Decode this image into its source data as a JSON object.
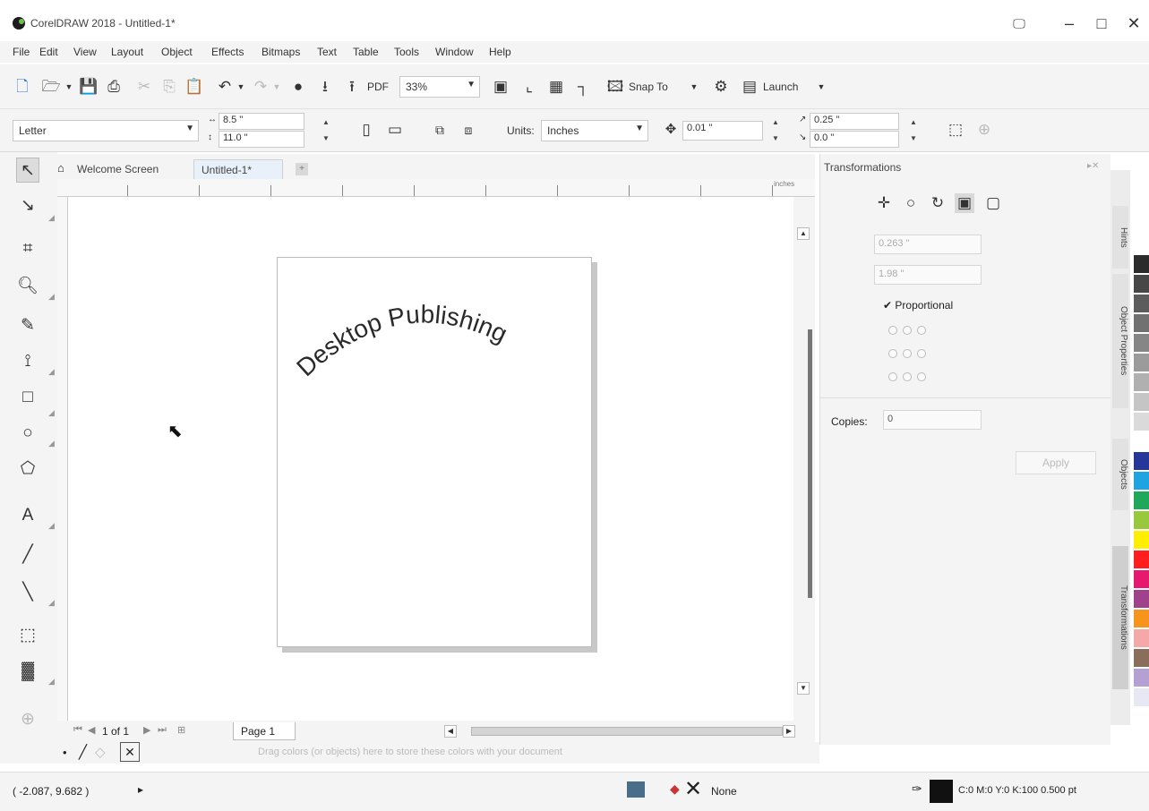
{
  "window": {
    "title": "CorelDRAW 2018 - Untitled-1*",
    "minimize": "–",
    "maximize": "□",
    "close": "✕"
  },
  "menu": [
    "File",
    "Edit",
    "View",
    "Layout",
    "Object",
    "Effects",
    "Bitmaps",
    "Text",
    "Table",
    "Tools",
    "Window",
    "Help"
  ],
  "toolbar": {
    "zoom_value": "33%",
    "snap_to_label": "Snap To",
    "launch_label": "Launch"
  },
  "property_bar": {
    "paper_type": "Letter",
    "width": "8.5 \"",
    "height": "11.0 \"",
    "units_label": "Units:",
    "units_value": "Inches",
    "nudge": "0.01 \"",
    "dup_x": "0.25 \"",
    "dup_y": "0.0 \""
  },
  "doc_tabs": [
    "Welcome Screen",
    "Untitled-1*"
  ],
  "ruler": {
    "unit_label": "inches"
  },
  "canvas": {
    "curved_text": "Desktop Publishing"
  },
  "page_nav": {
    "status": "1 of 1",
    "page_tab": "Page 1"
  },
  "hints": "Drag colors (or objects) here to store these colors with your document",
  "status_bar": {
    "coords": "( -2.087, 9.682 )",
    "fill_label": "None",
    "color_info": "C:0 M:0 Y:0 K:100  0.500 pt"
  },
  "docker": {
    "title": "Transformations",
    "field_1": "0.263 \"",
    "field_2": "1.98 \"",
    "proportional_label": "Proportional",
    "copies_label": "Copies:",
    "copies_value": "0",
    "apply_label": "Apply"
  },
  "docker_tabs": [
    "Hints",
    "Object Properties",
    "Objects",
    "Transformations"
  ],
  "palette_colors": [
    "#2b2b2b",
    "#474747",
    "#5c5c5c",
    "#717171",
    "#868686",
    "#9b9b9b",
    "#b0b0b0",
    "#c5c5c5",
    "#dadada",
    "#ffffff",
    "#26379a",
    "#1ea4e0",
    "#20a85a",
    "#98c83c",
    "#ffee00",
    "#ff1d1d",
    "#e6196e",
    "#a0418c",
    "#f7941d",
    "#f4a8a8",
    "#8a6e5a",
    "#b4a0d2",
    "#e8e8f4"
  ]
}
